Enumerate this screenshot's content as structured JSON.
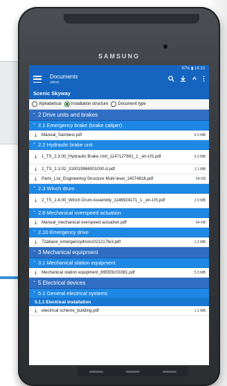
{
  "device": {
    "brand": "SAMSUNG"
  },
  "status": {
    "text": "97% ▮ 14:10"
  },
  "appbar": {
    "title": "Documents",
    "subtitle": "admin",
    "icons": [
      "menu-icon",
      "search-icon",
      "download-icon",
      "chevron-up-icon",
      "more-vert-icon"
    ]
  },
  "project": "Scenic Skyway",
  "sort": {
    "options": [
      "Alphabetical",
      "Installation structure",
      "Document type"
    ],
    "selected": "Installation structure"
  },
  "rows": [
    {
      "kind": "h1",
      "label": "2 Drive units and brakes"
    },
    {
      "kind": "h2",
      "label": "2.1 Emergency brake (brake caliper)"
    },
    {
      "kind": "file",
      "label": "Manual_Sambesi.pdf",
      "size": "9.3 MB"
    },
    {
      "kind": "h2",
      "label": "2.2 Hydraulic brake unit"
    },
    {
      "kind": "file2",
      "label": "1_TS_2.3.00_Hydraulic Brake Unit_1147127691_1._en-US.pdf",
      "size": "3.3 MB"
    },
    {
      "kind": "file",
      "label": "2_TS_2.3.02_310019968001000.d.pdf",
      "size": "1.1 MB"
    },
    {
      "kind": "file",
      "label": "Parts_List_Engineering Structure Multi level_14074816.pdf",
      "size": "54 KB"
    },
    {
      "kind": "h2",
      "label": "2.3 Winch drum"
    },
    {
      "kind": "file2",
      "label": "2_TS_2.4.00_Winch Drum Assembly_1146924171_1._en-US.pdf",
      "size": "2.9 MB"
    },
    {
      "kind": "h2",
      "label": "2.8 Mechanical overspeed actuation"
    },
    {
      "kind": "file",
      "label": "Manual_mechanical overspeed actuation.pdf",
      "size": "54 KB"
    },
    {
      "kind": "h2",
      "label": "2.10 Emergency drive"
    },
    {
      "kind": "file",
      "label": "72abace_emergencydrive1021217fe3.pdf",
      "size": "1.1 MB"
    },
    {
      "kind": "h1",
      "label": "3 Mechanical equipment"
    },
    {
      "kind": "h2",
      "label": "3.1 Mechanical station equipment"
    },
    {
      "kind": "file",
      "label": "Mechanical station equipment_8955f3c03381.pdf",
      "size": "3.3 MB"
    },
    {
      "kind": "h1",
      "label": "5 Electrical devices"
    },
    {
      "kind": "h2",
      "label": "5.1 General electrical systems"
    },
    {
      "kind": "h3",
      "label": "5.1.1 Electrical installation"
    },
    {
      "kind": "file",
      "label": "electrical scheme_building.pdf",
      "size": "1.1 MB"
    }
  ]
}
